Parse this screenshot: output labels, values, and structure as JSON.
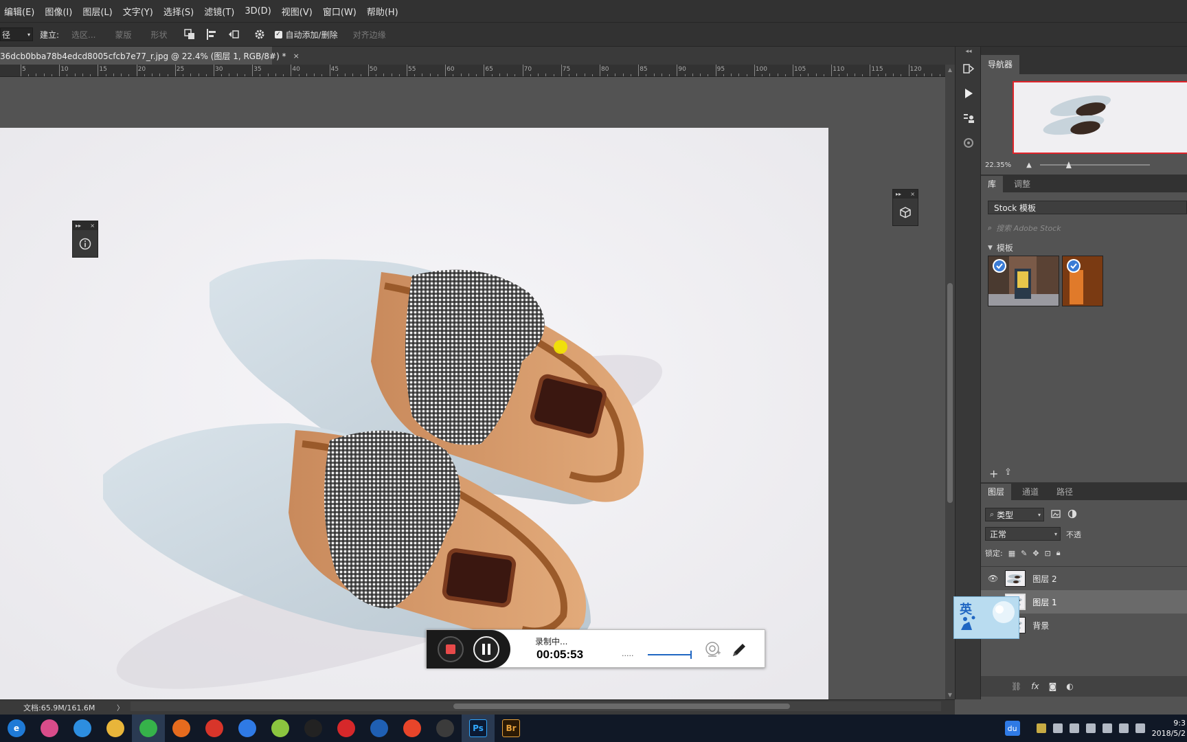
{
  "menu": [
    "编辑(E)",
    "图像(I)",
    "图层(L)",
    "文字(Y)",
    "选择(S)",
    "滤镜(T)",
    "3D(D)",
    "视图(V)",
    "窗口(W)",
    "帮助(H)"
  ],
  "options": {
    "tool_preset": "径",
    "make_label": "建立:",
    "selection_btn": "选区...",
    "mask_btn": "蒙版",
    "shape_btn": "形状",
    "auto_add_delete": "自动添加/删除",
    "align_edges": "对齐边缘"
  },
  "document": {
    "tab_title": "36dcb0bba78b4edcd8005cfcb7e77_r.jpg @ 22.4% (图层 1, RGB/8#) *",
    "close": "×"
  },
  "ruler": {
    "labels": [
      "5",
      "10",
      "15",
      "20",
      "25",
      "30",
      "35",
      "40",
      "45",
      "50",
      "55",
      "60",
      "65",
      "70",
      "75",
      "80",
      "85",
      "90",
      "95",
      "100",
      "105",
      "110",
      "115",
      "120"
    ]
  },
  "mini_panels": {
    "left_close": "×",
    "right_close": "×"
  },
  "navigator": {
    "tab": "导航器",
    "zoom": "22.35%"
  },
  "library": {
    "tabs": [
      "库",
      "调整"
    ],
    "dropdown": "Stock 模板",
    "search_placeholder": "搜索 Adobe Stock",
    "section": "模板"
  },
  "layers": {
    "tabs": [
      "图层",
      "通道",
      "路径"
    ],
    "filter": "类型",
    "blend_mode": "正常",
    "opacity_label": "不透",
    "lock_label": "锁定:",
    "items": [
      {
        "name": "图层 2"
      },
      {
        "name": "图层 1"
      },
      {
        "name": "背景"
      }
    ]
  },
  "status": {
    "doc_info": "文档:65.9M/161.6M",
    "arrow": "〉"
  },
  "recorder": {
    "status": "录制中...",
    "time": "00:05:53",
    "dots": "....."
  },
  "ime": {
    "label": "英"
  },
  "taskbar": {
    "apps": [
      {
        "name": "ie-icon",
        "label": "e",
        "color": "#1f7ad6"
      },
      {
        "name": "color-wheel-icon",
        "label": "",
        "color": "#d94c8a"
      },
      {
        "name": "qq-icon",
        "label": "",
        "color": "#2d8ee0"
      },
      {
        "name": "folder-icon",
        "label": "",
        "color": "#e8b53a"
      },
      {
        "name": "wechat-icon",
        "label": "",
        "color": "#36b24a"
      },
      {
        "name": "firefox-icon",
        "label": "",
        "color": "#e66b1e"
      },
      {
        "name": "chrome-icon",
        "label": "",
        "color": "#d8352a"
      },
      {
        "name": "baidu-netdisk-icon",
        "label": "",
        "color": "#2f7ae5"
      },
      {
        "name": "360-icon",
        "label": "",
        "color": "#8bc53f"
      },
      {
        "name": "qq-penguin-icon",
        "label": "",
        "color": "#222222"
      },
      {
        "name": "netease-music-icon",
        "label": "",
        "color": "#d6282a"
      },
      {
        "name": "browser-icon",
        "label": "",
        "color": "#1f5fb3"
      },
      {
        "name": "music-app-icon",
        "label": "",
        "color": "#e8452a"
      },
      {
        "name": "davinci-icon",
        "label": "",
        "color": "#3b3b3b"
      },
      {
        "name": "photoshop-icon",
        "label": "Ps",
        "color": "#0c1a33"
      },
      {
        "name": "bridge-icon",
        "label": "Br",
        "color": "#2b1a05"
      }
    ],
    "tray_du": "du",
    "clock_time": "9:3",
    "clock_date": "2018/5/2"
  },
  "colors": {
    "accent_blue": "#3a7bd5",
    "recorder_time": "#000000",
    "nav_red": "#e0242a"
  }
}
